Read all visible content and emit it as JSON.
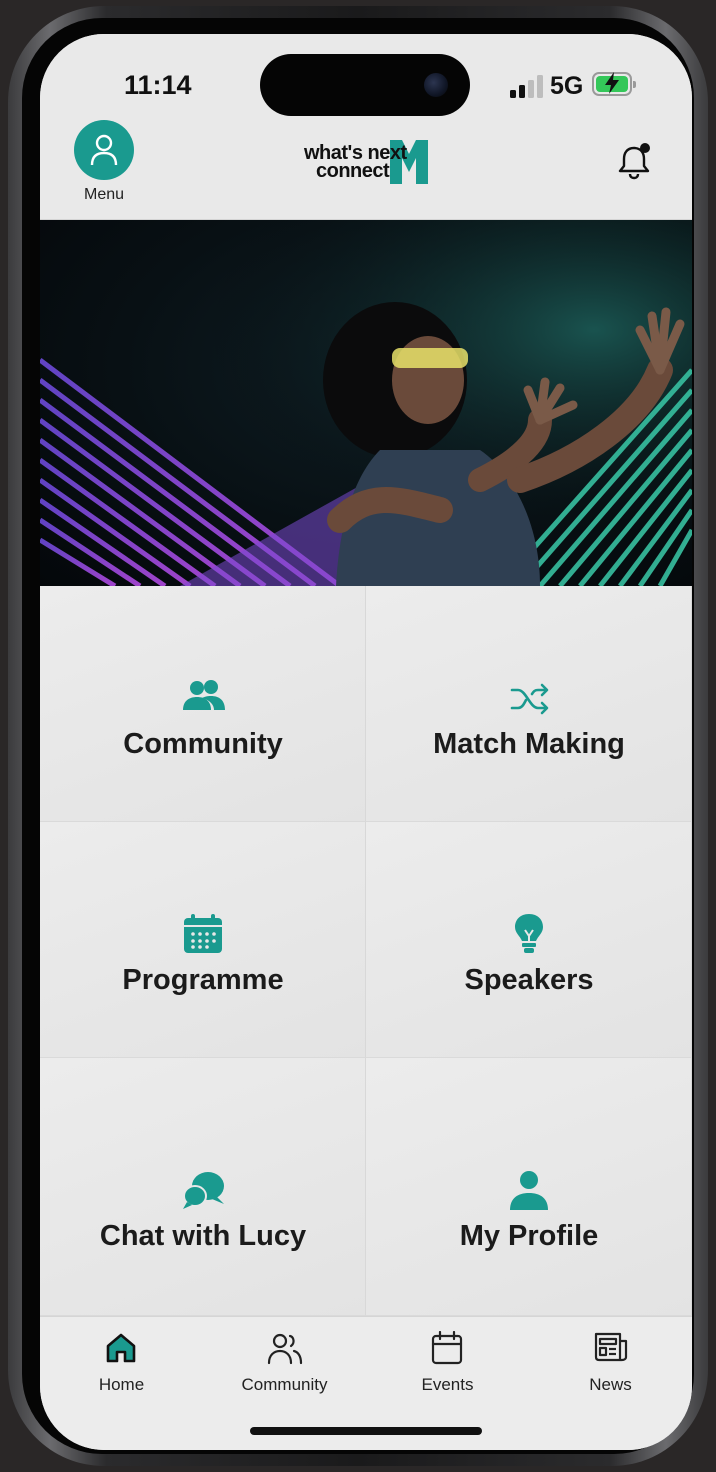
{
  "status": {
    "time": "11:14",
    "network": "5G",
    "icons": [
      "signal-icon",
      "battery-charging-icon"
    ]
  },
  "header": {
    "menu_label": "Menu",
    "logo_line1": "what's next",
    "logo_line2": "connect",
    "icons": [
      "person-icon",
      "bell-icon"
    ]
  },
  "colors": {
    "accent": "#1a9a8f",
    "background": "#e9e9e9",
    "text": "#1b1b1b"
  },
  "tiles": [
    {
      "label": "Community",
      "icon": "people-icon"
    },
    {
      "label": "Match Making",
      "icon": "shuffle-icon"
    },
    {
      "label": "Programme",
      "icon": "calendar-icon"
    },
    {
      "label": "Speakers",
      "icon": "lightbulb-icon"
    },
    {
      "label": "Chat with Lucy",
      "icon": "chat-bubbles-icon"
    },
    {
      "label": "My Profile",
      "icon": "person-icon"
    }
  ],
  "tabs": [
    {
      "label": "Home",
      "icon": "home-icon"
    },
    {
      "label": "Community",
      "icon": "people-outline-icon"
    },
    {
      "label": "Events",
      "icon": "calendar-outline-icon"
    },
    {
      "label": "News",
      "icon": "newspaper-icon"
    }
  ]
}
